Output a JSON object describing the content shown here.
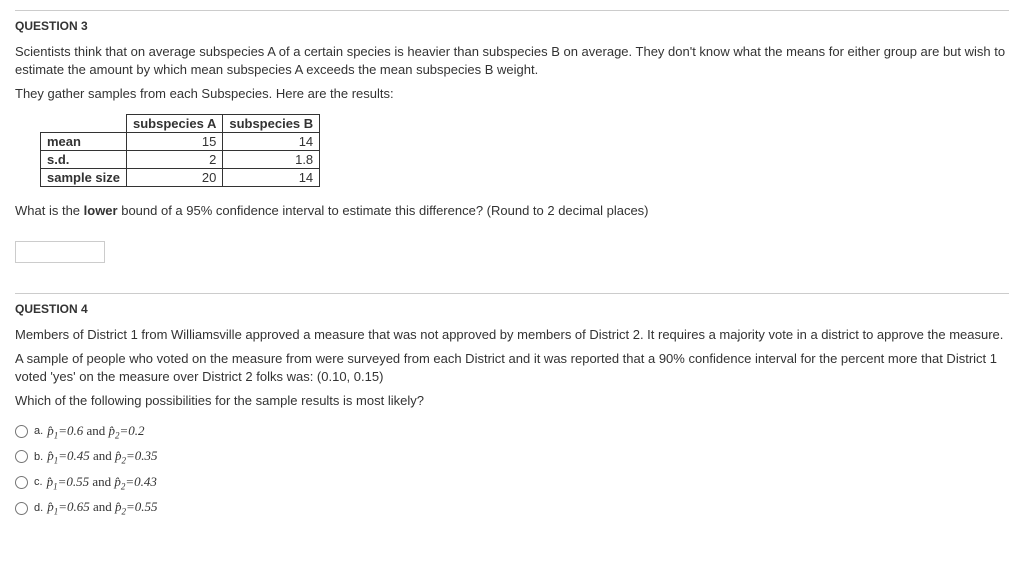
{
  "q3": {
    "title": "QUESTION 3",
    "intro1": "Scientists think that on average subspecies A of a certain species is heavier than subspecies B on average.  They don't know what the means for either group are but wish to estimate the amount by which mean subspecies A exceeds the mean subspecies B weight.",
    "intro2": "They gather samples from each Subspecies.  Here are the results:",
    "table": {
      "col1": "subspecies A",
      "col2": "subspecies B",
      "row1_label": "mean",
      "row1_v1": "15",
      "row1_v2": "14",
      "row2_label": "s.d.",
      "row2_v1": "2",
      "row2_v2": "1.8",
      "row3_label": "sample size",
      "row3_v1": "20",
      "row3_v2": "14"
    },
    "prompt_before": "What is the ",
    "prompt_bold": "lower",
    "prompt_after": " bound of a 95% confidence interval to estimate this difference?  (Round to 2 decimal places)"
  },
  "q4": {
    "title": "QUESTION 4",
    "intro1": "Members of District 1 from Williamsville approved a measure that was not approved by members of District 2.   It requires a majority vote in a district to approve the measure.",
    "intro2": "A sample of people who voted on the measure from were surveyed from each District and it was reported that a  90% confidence interval for the percent more that District 1 voted 'yes' on the measure over District 2 folks was:   (0.10, 0.15)",
    "intro3": "Which of the following possibilities for the sample results is most likely?",
    "opts": {
      "a_label": "a.",
      "a_text": "p̂₁=0.6 and p̂₂=0.2",
      "b_label": "b.",
      "b_text": "p̂₁=0.45 and p̂₂=0.35",
      "c_label": "c.",
      "c_text": "p̂₁=0.55 and p̂₂=0.43",
      "d_label": "d.",
      "d_text": "p̂₁=0.65 and p̂₂=0.55"
    }
  }
}
